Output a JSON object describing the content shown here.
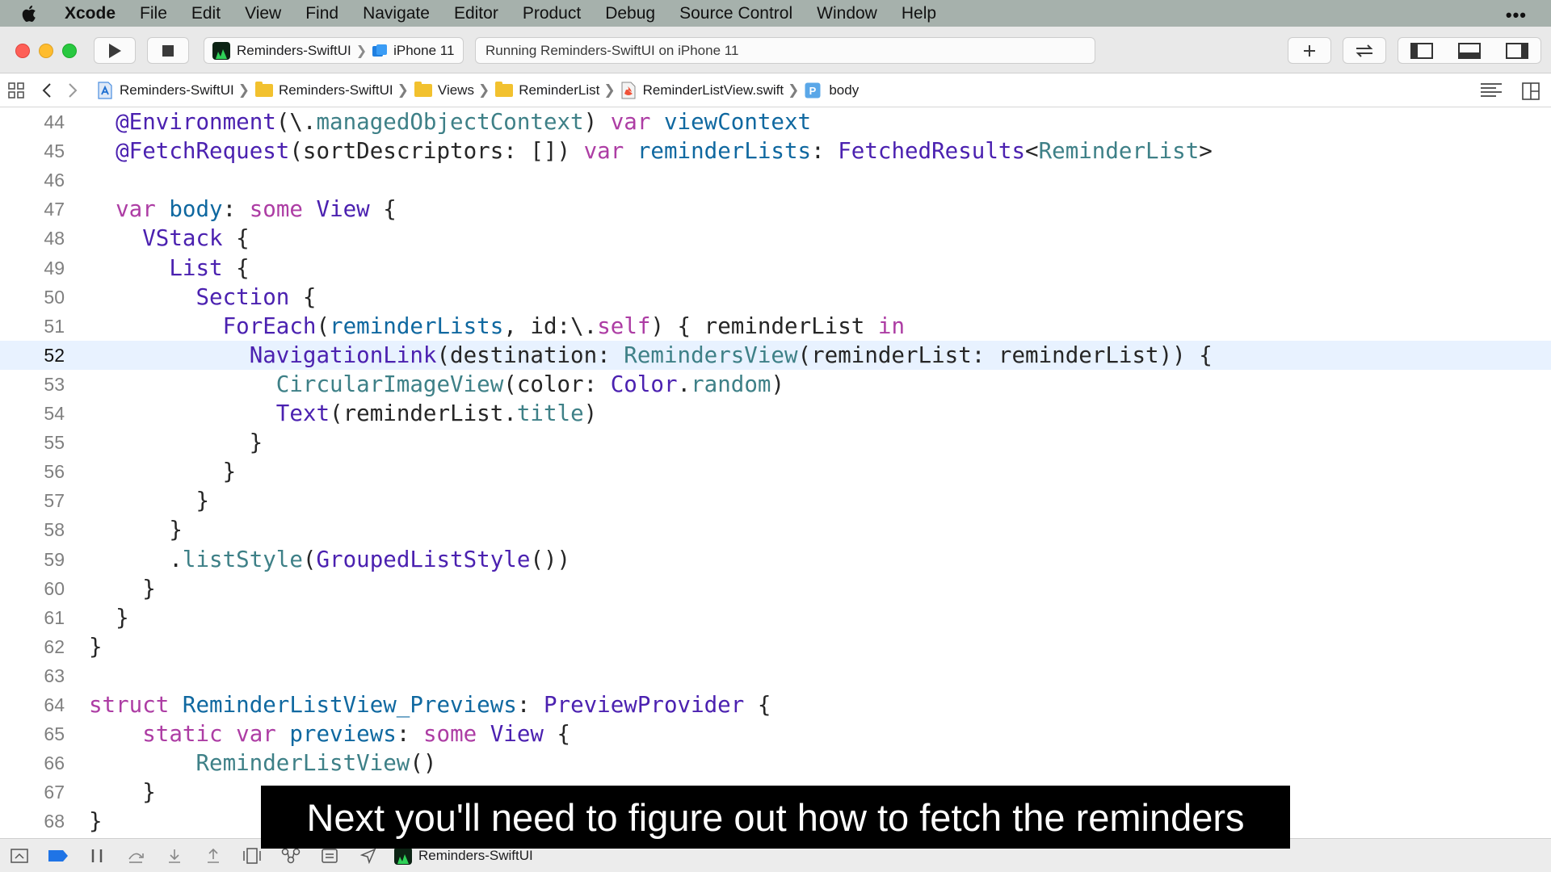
{
  "menubar": {
    "app": "Xcode",
    "items": [
      "File",
      "Edit",
      "View",
      "Find",
      "Navigate",
      "Editor",
      "Product",
      "Debug",
      "Source Control",
      "Window",
      "Help"
    ],
    "more": "•••"
  },
  "toolbar": {
    "scheme": "Reminders-SwiftUI",
    "device": "iPhone 11",
    "status": "Running Reminders-SwiftUI on iPhone 11"
  },
  "jumpbar": {
    "crumbs": [
      "Reminders-SwiftUI",
      "Reminders-SwiftUI",
      "Views",
      "ReminderList",
      "ReminderListView.swift",
      "body"
    ]
  },
  "editor": {
    "current_line": "52",
    "lines": [
      {
        "n": "44",
        "code": "  @Environment(\\.managedObjectContext) var viewContext"
      },
      {
        "n": "45",
        "code": "  @FetchRequest(sortDescriptors: []) var reminderLists: FetchedResults<ReminderList>"
      },
      {
        "n": "46",
        "code": ""
      },
      {
        "n": "47",
        "code": "  var body: some View {"
      },
      {
        "n": "48",
        "code": "    VStack {"
      },
      {
        "n": "49",
        "code": "      List {"
      },
      {
        "n": "50",
        "code": "        Section {"
      },
      {
        "n": "51",
        "code": "          ForEach(reminderLists, id:\\.self) { reminderList in"
      },
      {
        "n": "52",
        "code": "            NavigationLink(destination: RemindersView(reminderList: reminderList)) {"
      },
      {
        "n": "53",
        "code": "              CircularImageView(color: Color.random)"
      },
      {
        "n": "54",
        "code": "              Text(reminderList.title)"
      },
      {
        "n": "55",
        "code": "            }"
      },
      {
        "n": "56",
        "code": "          }"
      },
      {
        "n": "57",
        "code": "        }"
      },
      {
        "n": "58",
        "code": "      }"
      },
      {
        "n": "59",
        "code": "      .listStyle(GroupedListStyle())"
      },
      {
        "n": "60",
        "code": "    }"
      },
      {
        "n": "61",
        "code": "  }"
      },
      {
        "n": "62",
        "code": "}"
      },
      {
        "n": "63",
        "code": ""
      },
      {
        "n": "64",
        "code": "struct ReminderListView_Previews: PreviewProvider {"
      },
      {
        "n": "65",
        "code": "    static var previews: some View {"
      },
      {
        "n": "66",
        "code": "        ReminderListView()"
      },
      {
        "n": "67",
        "code": "    }"
      },
      {
        "n": "68",
        "code": "}"
      }
    ]
  },
  "debugbar": {
    "target": "Reminders-SwiftUI"
  },
  "caption": "Next you'll need to figure out how to fetch the reminders"
}
